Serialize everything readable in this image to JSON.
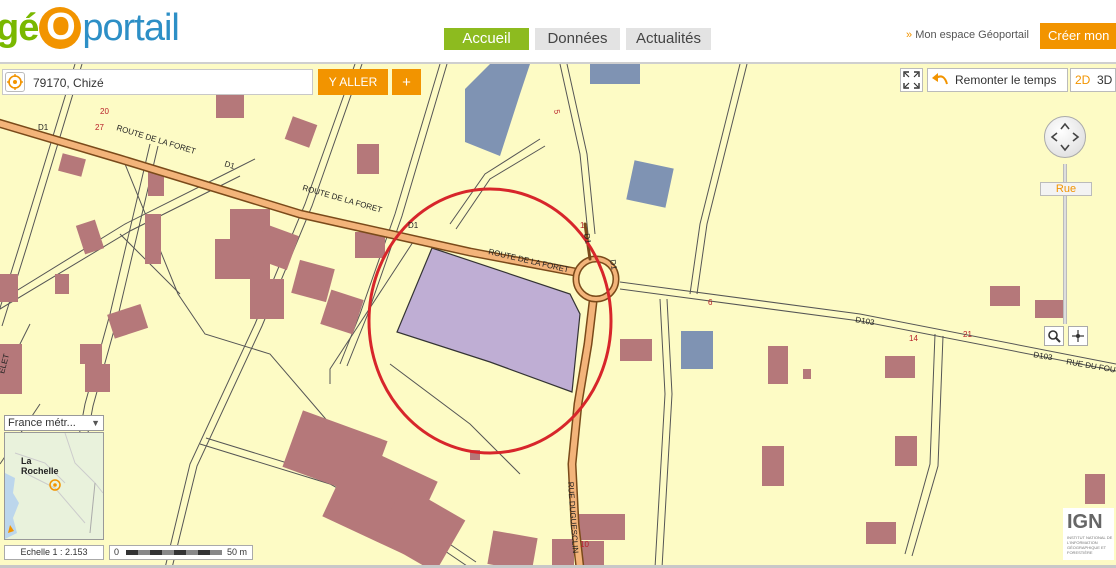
{
  "header": {
    "logo": {
      "g": "g",
      "e": "é",
      "o": "O",
      "rest": "portail"
    },
    "tabs": [
      {
        "label": "Accueil",
        "active": true
      },
      {
        "label": "Données",
        "active": false
      },
      {
        "label": "Actualités",
        "active": false
      }
    ],
    "espace_arrow": "»",
    "espace_label": "Mon espace Géoportail",
    "creer_label": "Créer mon"
  },
  "toolbar": {
    "search_value": "79170, Chizé",
    "aller_label": "Y ALLER",
    "plus_label": "+",
    "remonter_label": "Remonter le temps",
    "mode_2d": "2D",
    "mode_3d": "3D"
  },
  "zoom": {
    "label": "Rue"
  },
  "map_labels": {
    "roads": [
      "ROUTE DE LA FORET",
      "ROUTE DE LA FORET",
      "ROUTE DE LA FORET",
      "RUE DUGUESCLIN",
      "D103",
      "D103",
      "RUE DU FOU",
      "D1",
      "D1",
      "D1",
      "D1",
      "D1",
      "ELET"
    ],
    "numbers": [
      "20",
      "27",
      "5",
      "6",
      "14",
      "21",
      "1",
      "10"
    ]
  },
  "bottom": {
    "layer_select": "France métr...",
    "layer_arrow": "▼",
    "minimap_city_1": "La",
    "minimap_city_2": "Rochelle",
    "echelle": "Echelle 1 :  2.153",
    "scale_zero": "0",
    "scale_dist": "50 m"
  },
  "ign": {
    "logo": "IGN",
    "caption": "INSTITUT NATIONAL DE L'INFORMATION GÉOGRAPHIQUE ET FORESTIÈRE"
  },
  "colors": {
    "orange": "#f29400",
    "green": "#8dbb1f",
    "blue": "#2d8fc6",
    "map_bg": "#fdfbc5",
    "building": "#b5787a",
    "parcel": "#bfaed4",
    "circle": "#d7262b"
  },
  "icons": [
    "locate-icon",
    "fullscreen-icon",
    "undo-arrow-icon",
    "compass-icon",
    "zoom-select-icon",
    "pan-select-icon",
    "dropdown-arrow-icon",
    "ign-logo"
  ]
}
